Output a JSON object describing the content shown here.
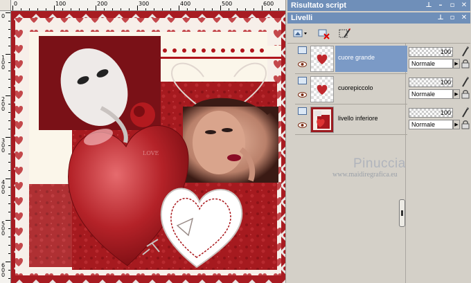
{
  "ruler": {
    "top_labels": [
      "0",
      "100",
      "200",
      "300",
      "400",
      "500",
      "600"
    ],
    "left_labels": [
      "0",
      "1\n0\n0",
      "2\n0\n0",
      "3\n0\n0",
      "4\n0\n0",
      "5\n0\n0",
      "6\n0\n0"
    ]
  },
  "script_panel": {
    "title": "Risultato script",
    "buttons": [
      "pin-icon",
      "minimize-icon",
      "maximize-icon",
      "close-icon"
    ]
  },
  "layers_panel": {
    "title": "Livelli",
    "buttons": [
      "pin-icon",
      "maximize-icon",
      "close-icon"
    ],
    "toolbar": [
      "new-layer-icon",
      "delete-layer-icon",
      "layer-properties-icon"
    ],
    "layers": [
      {
        "name": "cuore grande",
        "opacity": "100",
        "blend": "Normale",
        "selected": true
      },
      {
        "name": "cuorepiccolo",
        "opacity": "100",
        "blend": "Normale",
        "selected": false
      },
      {
        "name": "livello inferiore",
        "opacity": "100",
        "blend": "Normale",
        "selected": false
      }
    ]
  },
  "watermark": {
    "name": "Pinuccia",
    "url": "www.maidiregrafica.eu"
  },
  "colors": {
    "panel_title": "#6f8fb9",
    "selected_layer": "#7b9ac6",
    "art_red": "#a3191c"
  }
}
